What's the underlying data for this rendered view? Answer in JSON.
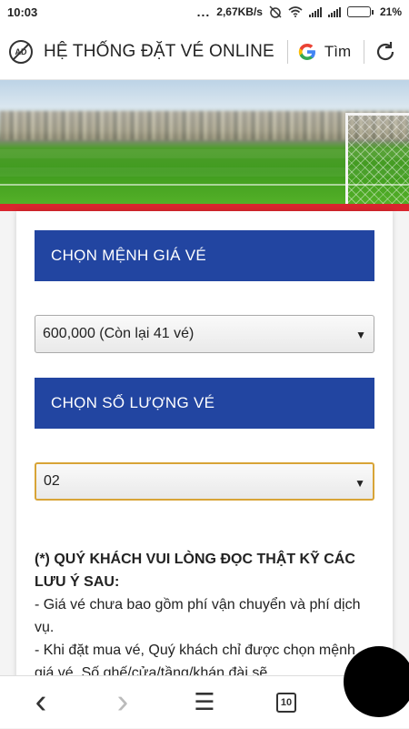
{
  "status_bar": {
    "time": "10:03",
    "dots": "...",
    "speed": "2,67KB/s",
    "battery": "21%",
    "battery_level": 0.21
  },
  "toolbar": {
    "title": "HỆ THỐNG ĐẶT VÉ ONLINE",
    "search_label": "Tìm",
    "icons": [
      "adblock-icon",
      "google-icon",
      "reload-icon"
    ],
    "adblock_text": "AD"
  },
  "form": {
    "price_header": "CHỌN MỆNH GIÁ VÉ",
    "price_select_value": "600,000 (Còn lại 41 vé)",
    "quantity_header": "CHỌN SỐ LƯỢNG VÉ",
    "quantity_select_value": "02",
    "arrow": "▼"
  },
  "notice": {
    "heading": "(*) QUÝ KHÁCH VUI LÒNG ĐỌC THẬT KỸ CÁC LƯU Ý SAU:",
    "line1": "- Giá vé chưa bao gồm phí vận chuyển và phí dịch vụ.",
    "line2": "- Khi đặt mua vé, Quý khách chỉ được chọn mệnh giá vé. Số ghế/cửa/tầng/khán đài sẽ"
  },
  "bottom_nav": {
    "back": "‹",
    "forward": "›",
    "menu": "☰",
    "tabs_count": "10"
  },
  "colors": {
    "header_blue": "#2245a1",
    "banner_red": "#d9262e",
    "focus_border": "#d8a437"
  }
}
